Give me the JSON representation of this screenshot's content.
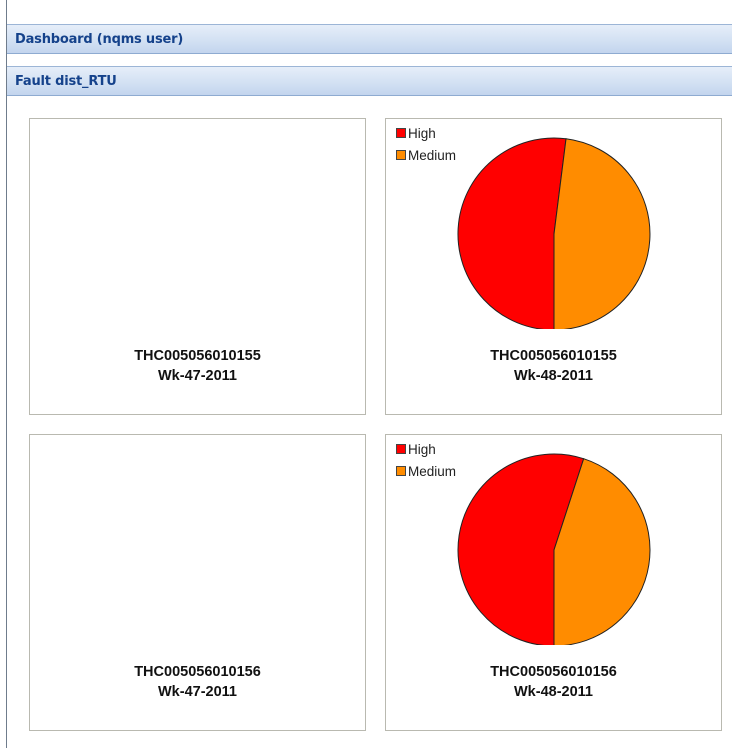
{
  "window": {
    "title": "Dashboard (nqms user)",
    "section_title": "Fault dist_RTU"
  },
  "legend_colors": {
    "High": "#ff0000",
    "Medium": "#ff8c00"
  },
  "panels": [
    {
      "device": "THC005056010155",
      "week": "Wk-47-2011"
    },
    {
      "device": "THC005056010155",
      "week": "Wk-48-2011",
      "legend": [
        "High",
        "Medium"
      ]
    },
    {
      "device": "THC005056010156",
      "week": "Wk-47-2011"
    },
    {
      "device": "THC005056010156",
      "week": "Wk-48-2011",
      "legend": [
        "High",
        "Medium"
      ]
    }
  ],
  "chart_data": [
    {
      "type": "pie",
      "panel": "THC005056010155 Wk-48-2011",
      "categories": [
        "High",
        "Medium"
      ],
      "values": [
        52,
        48
      ],
      "colors": [
        "#ff0000",
        "#ff8c00"
      ]
    },
    {
      "type": "pie",
      "panel": "THC005056010156 Wk-48-2011",
      "categories": [
        "High",
        "Medium"
      ],
      "values": [
        55,
        45
      ],
      "colors": [
        "#ff0000",
        "#ff8c00"
      ]
    }
  ]
}
